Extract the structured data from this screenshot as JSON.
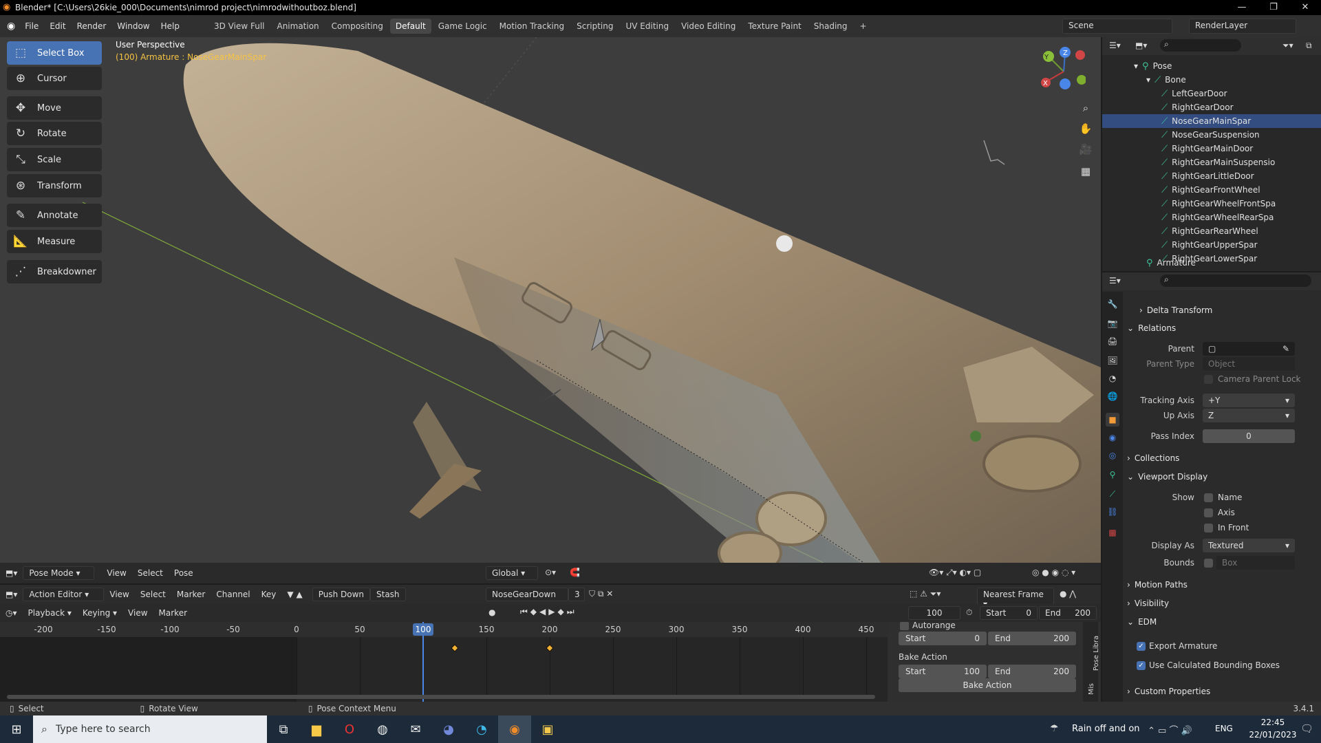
{
  "window": {
    "title": "Blender* [C:\\Users\\26kie_000\\Documents\\nimrod project\\nimrodwithoutboz.blend]"
  },
  "menu": [
    "File",
    "Edit",
    "Render",
    "Window",
    "Help"
  ],
  "workspaces": [
    "3D View Full",
    "Animation",
    "Compositing",
    "Default",
    "Game Logic",
    "Motion Tracking",
    "Scripting",
    "UV Editing",
    "Video Editing",
    "Texture Paint",
    "Shading"
  ],
  "active_workspace": "Default",
  "scene": {
    "name": "Scene",
    "render_layer": "RenderLayer"
  },
  "viewport": {
    "view_name": "User Perspective",
    "object_info": "(100) Armature : NoseGearMainSpar",
    "mode": "Pose Mode",
    "menus": [
      "View",
      "Select",
      "Pose"
    ],
    "orientation": "Global"
  },
  "tools": [
    "Select Box",
    "Cursor",
    "Move",
    "Rotate",
    "Scale",
    "Transform",
    "Annotate",
    "Measure",
    "Breakdowner"
  ],
  "gizmo": {
    "x": "X",
    "y": "Y",
    "z": "Z"
  },
  "action_editor": {
    "mode": "Action Editor",
    "menus": [
      "View",
      "Select",
      "Marker",
      "Channel",
      "Key"
    ],
    "push_down": "Push Down",
    "stash": "Stash",
    "action_name": "NoseGearDown",
    "users": "3",
    "snap": "Nearest Frame"
  },
  "timeline": {
    "menus": [
      "Playback",
      "Keying",
      "View",
      "Marker"
    ],
    "current_frame": "100",
    "start_label": "Start",
    "start": "0",
    "end_label": "End",
    "end": "200",
    "ticks": [
      "-200",
      "-150",
      "-100",
      "-50",
      "0",
      "50",
      "100",
      "150",
      "200",
      "250",
      "300",
      "350",
      "400",
      "450"
    ],
    "keyframes": [
      125,
      200
    ]
  },
  "bake": {
    "autorange": "Autorange",
    "range_start_label": "Start",
    "range_start": "0",
    "range_end_label": "End",
    "range_end": "200",
    "bake_action_label": "Bake Action",
    "bake_start_label": "Start",
    "bake_start": "100",
    "bake_end_label": "End",
    "bake_end": "200",
    "bake_button": "Bake Action",
    "side_tabs": [
      "Pose Libra",
      "Mis"
    ]
  },
  "outliner": {
    "pose": "Pose",
    "bone": "Bone",
    "bones": [
      "LeftGearDoor",
      "RightGearDoor",
      "NoseGearMainSpar",
      "NoseGearSuspension",
      "RightGearMainDoor",
      "RightGearMainSuspensio",
      "RightGearLittleDoor",
      "RightGearFrontWheel",
      "RightGearWheelFrontSpa",
      "RightGearWheelRearSpa",
      "RightGearRearWheel",
      "RightGearUpperSpar",
      "RightGearLowerSpar"
    ],
    "selected": "NoseGearMainSpar",
    "armature": "Armature"
  },
  "properties": {
    "delta_transform": "Delta Transform",
    "relations": "Relations",
    "parent_label": "Parent",
    "parent_type_label": "Parent Type",
    "parent_type": "Object",
    "camera_parent_lock": "Camera Parent Lock",
    "tracking_axis_label": "Tracking Axis",
    "tracking_axis": "+Y",
    "up_axis_label": "Up Axis",
    "up_axis": "Z",
    "pass_index_label": "Pass Index",
    "pass_index": "0",
    "collections": "Collections",
    "viewport_display": "Viewport Display",
    "show_label": "Show",
    "show_name": "Name",
    "show_axis": "Axis",
    "show_in_front": "In Front",
    "display_as_label": "Display As",
    "display_as": "Textured",
    "bounds_label": "Bounds",
    "bounds": "Box",
    "motion_paths": "Motion Paths",
    "visibility": "Visibility",
    "edm": "EDM",
    "export_armature": "Export Armature",
    "use_calc_bounds": "Use Calculated Bounding Boxes",
    "custom_properties": "Custom Properties"
  },
  "status": {
    "left": "Select",
    "middle": "Rotate View",
    "right": "Pose Context Menu",
    "version": "3.4.1"
  },
  "taskbar": {
    "search_placeholder": "Type here to search",
    "weather": "Rain off and on",
    "lang": "ENG",
    "time": "22:45",
    "date": "22/01/2023"
  },
  "colors": {
    "accent": "#4772b3",
    "bone": "#3ec59c",
    "keyframe": "#f2b233",
    "header_text": "#f6c343"
  }
}
